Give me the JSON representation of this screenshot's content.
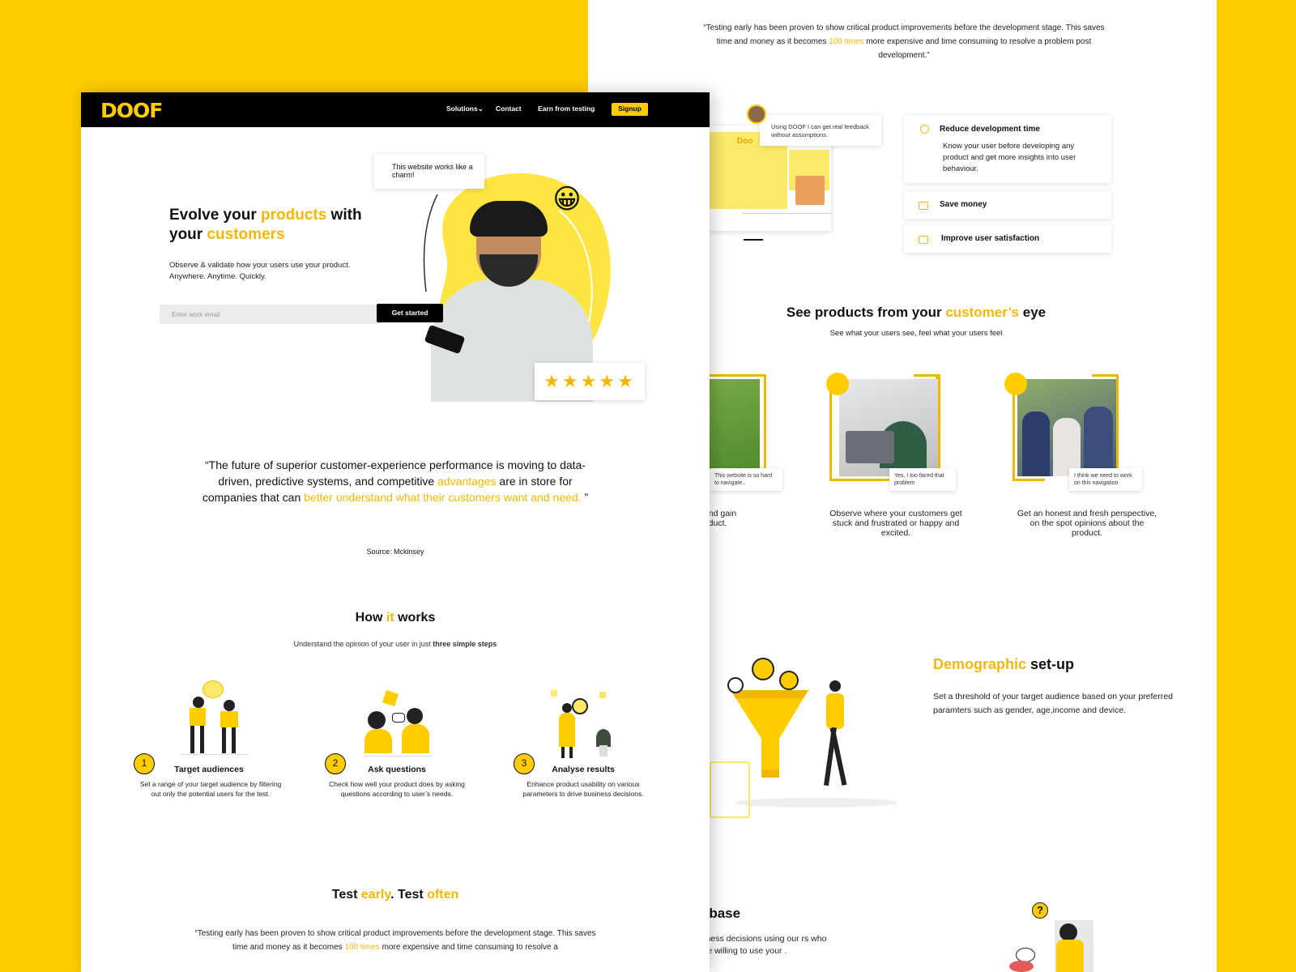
{
  "back": {
    "top_quote": {
      "pre": "“Testing early has been proven to show critical product improvements before the development stage. This saves time and money as it becomes ",
      "hl": "100 times",
      "post": " more expensive and time consuming to resolve a problem post development.”"
    },
    "feedback_bubble": "Using DOOF I can get real feedback without assumptions.",
    "mini_logo": "Doo",
    "features": [
      {
        "title": "Reduce development time",
        "desc": "Know your user before developing any product and get more insights into user behaviour."
      },
      {
        "title": "Save money"
      },
      {
        "title": "Improve user satisfaction"
      }
    ],
    "see": {
      "pre": "See products from your ",
      "hl": "customer’s",
      "post": " eye",
      "sub": "See what your users see, feel what your users feel"
    },
    "personas": [
      {
        "bubble": "This website is so hard to navigate..",
        "caption": "our user’s pain nd gain insights r product."
      },
      {
        "bubble": "Yes, I too faced that problem",
        "caption": "Observe where your customers get stuck and frustrated or happy and excited."
      },
      {
        "bubble": "I think we need to work on this navigation",
        "caption": "Get an honest and fresh perspective, on the spot opinions about the product."
      }
    ],
    "demographic": {
      "hl": "Demographic",
      "post": " set-up",
      "desc": "Set a threshold of your target audience based on  your preferred paramters such as gender, age,income and device."
    },
    "user_base": {
      "hl": "r",
      "post": " base",
      "desc": "siness decisions using our rs who are willing to use your ."
    },
    "qmark": "?"
  },
  "nav": {
    "logo": "DOOF",
    "links": [
      "Solutions⌄",
      "Contact",
      "Earn from testing"
    ],
    "signup": "Signup"
  },
  "hero": {
    "t1": "Evolve your ",
    "t1_hl": "products",
    "t1_end": " with",
    "t2": "your ",
    "t2_hl": "customers",
    "sub": "Observe & validate how your users use your product. Anywhere. Anytime. Quickly.",
    "email_placeholder": "Enter work email",
    "cta": "Get started",
    "speech": "This website works like a charm!",
    "stars": "★★★★★",
    "emoji": "😀"
  },
  "quote": {
    "p1": "“The future of superior customer-experience performance is moving to data-driven, predictive systems, and competitive ",
    "hl1": "advantages",
    "p2": " are in store for companies that can ",
    "hl2": "better understand what their customers want and need.",
    "p3": " ”",
    "source": "Source: Mckinsey"
  },
  "how": {
    "pre": "How ",
    "hl": "it",
    "post": " works",
    "sub_pre": "Understand the opinion of your user in just ",
    "sub_bold": "three simple steps",
    "steps": [
      {
        "num": "1",
        "title": "Target audiences",
        "desc": "Set a range of your target audience by filtering out only the potential users for the test."
      },
      {
        "num": "2",
        "title": "Ask questions",
        "desc": "Check how well your product does by asking questions according to user’s needs."
      },
      {
        "num": "3",
        "title": "Analyse results",
        "desc": "Enhance product usability on various parameters to drive business decisions."
      }
    ]
  },
  "test": {
    "a": "Test ",
    "hl1": "early",
    "b": ". Test ",
    "hl2": "often",
    "q_pre": "“Testing early has been proven to show critical product improvements before the development stage. This saves time and money as it becomes ",
    "q_hl": "100 times",
    "q_post": " more expensive and time consuming to resolve a"
  },
  "colors": {
    "accent": "#FFCC00",
    "accent_text": "#F2B705",
    "nav": "#000000"
  }
}
